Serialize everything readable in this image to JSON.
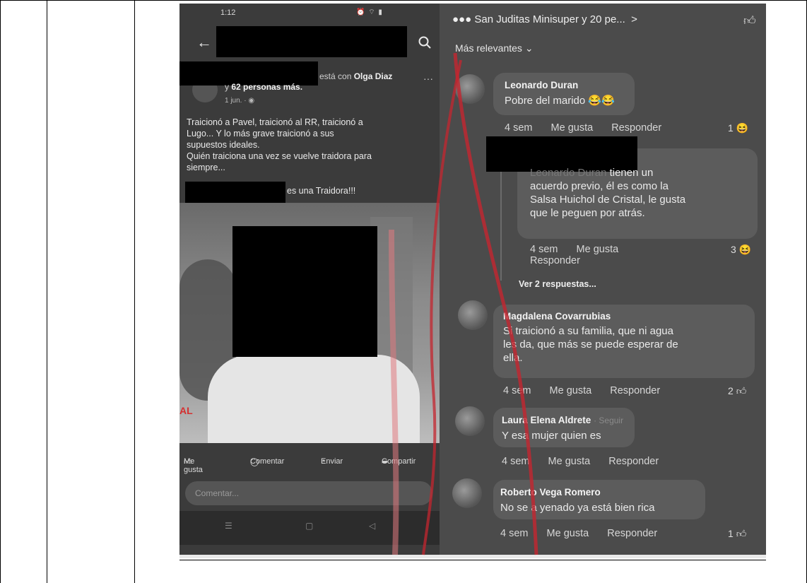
{
  "left_panel": {
    "status_time": "1:12",
    "author_suffix": "está con",
    "tagged_name": "Olga Diaz",
    "others_prefix": "y",
    "others_count": "62 personas más.",
    "post_date": "1 jun. · ",
    "post_text_lines": [
      "Traicionó a Pavel, traicionó al RR, traicionó a",
      "Lugo... Y lo más grave traicionó a sus",
      "supuestos ideales.",
      "Quién traiciona una vez se vuelve traidora para",
      "siempre..."
    ],
    "traitor_text": "es una Traidora!!!",
    "photo_text": "AL",
    "actions": {
      "like": "Me gusta",
      "comment": "Comentar",
      "send": "Enviar",
      "share": "Compartir"
    },
    "comment_placeholder": "Comentar..."
  },
  "right_panel": {
    "reactions_text": "San Juditas Minisuper y 20 pe...",
    "sort_label": "Más relevantes",
    "comments": [
      {
        "name": "Leonardo Duran",
        "text": "Pobre del marido",
        "time": "4 sem",
        "like": "Me gusta",
        "reply": "Responder",
        "count": "1"
      },
      {
        "name_partial": "Leonardo Duran",
        "text_lines": [
          "tienen un",
          "acuerdo previo, él es como la",
          "Salsa Huichol de Cristal, le gusta",
          "que le peguen por atrás."
        ],
        "time": "4 sem",
        "like": "Me gusta",
        "reply": "Responder",
        "count": "3",
        "view_replies": "Ver 2 respuestas..."
      },
      {
        "name": "Magdalena Covarrubias",
        "text_lines": [
          "Si traicionó a su familia, que ni agua",
          "les da, que más se puede esperar de",
          "ella."
        ],
        "time": "4 sem",
        "like": "Me gusta",
        "reply": "Responder",
        "count": "2"
      },
      {
        "name": "Laura Elena Aldrete",
        "follow": "· Seguir",
        "text": "Y esa mujer quien es",
        "time": "4 sem",
        "like": "Me gusta",
        "reply": "Responder"
      },
      {
        "name": "Roberto Vega Romero",
        "text": "No se a yenado ya está bien rica",
        "time": "4 sem",
        "like": "Me gusta",
        "reply": "Responder",
        "count": "1"
      }
    ]
  }
}
